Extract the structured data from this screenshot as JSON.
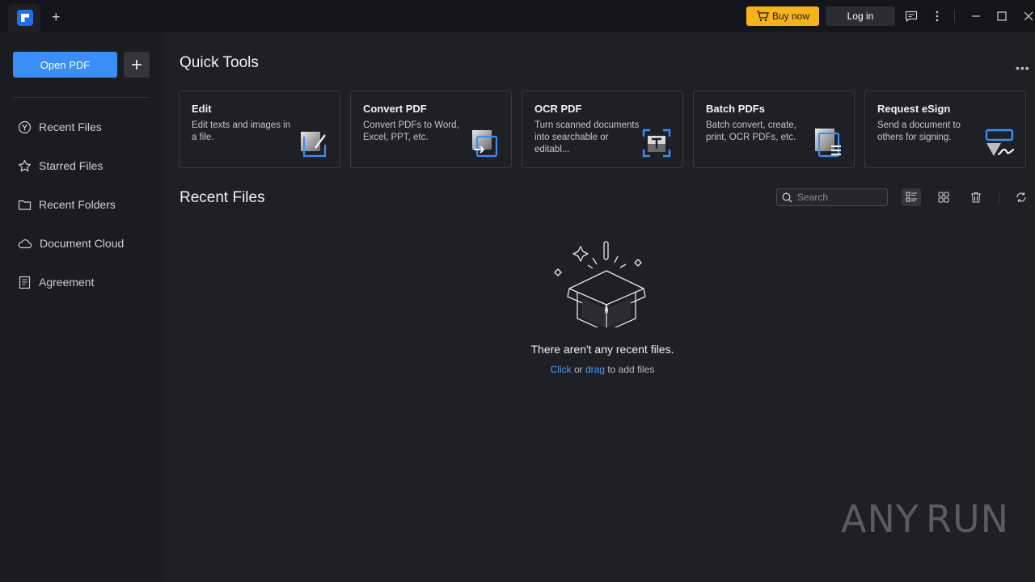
{
  "titlebar": {
    "buy_label": "Buy now",
    "login_label": "Log in"
  },
  "sidebar": {
    "open_pdf_label": "Open PDF",
    "items": [
      {
        "label": "Recent Files",
        "icon": "recent-icon"
      },
      {
        "label": "Starred Files",
        "icon": "star-icon"
      },
      {
        "label": "Recent Folders",
        "icon": "folder-icon"
      },
      {
        "label": "Document Cloud",
        "icon": "cloud-icon"
      },
      {
        "label": "Agreement",
        "icon": "agreement-icon"
      }
    ]
  },
  "quick_tools": {
    "title": "Quick Tools",
    "cards": [
      {
        "title": "Edit",
        "desc": "Edit texts and images in a file.",
        "icon": "edit-icon"
      },
      {
        "title": "Convert PDF",
        "desc": "Convert PDFs to Word, Excel, PPT, etc.",
        "icon": "convert-icon"
      },
      {
        "title": "OCR PDF",
        "desc": "Turn scanned documents into searchable or editabl...",
        "icon": "ocr-icon"
      },
      {
        "title": "Batch PDFs",
        "desc": "Batch convert, create, print, OCR PDFs, etc.",
        "icon": "batch-icon"
      },
      {
        "title": "Request eSign",
        "desc": "Send a document to others for signing.",
        "icon": "esign-icon"
      }
    ]
  },
  "recent": {
    "title": "Recent Files",
    "search_placeholder": "Search",
    "empty_title": "There aren't any recent files.",
    "empty_click": "Click",
    "empty_or": " or ",
    "empty_drag": "drag",
    "empty_tail": " to add files"
  },
  "watermark": {
    "left": "ANY",
    "right": "RUN"
  },
  "colors": {
    "accent": "#3b8ef5",
    "buy": "#f7b31c",
    "background": "#1f2026",
    "sidebar": "#1b1c21"
  }
}
